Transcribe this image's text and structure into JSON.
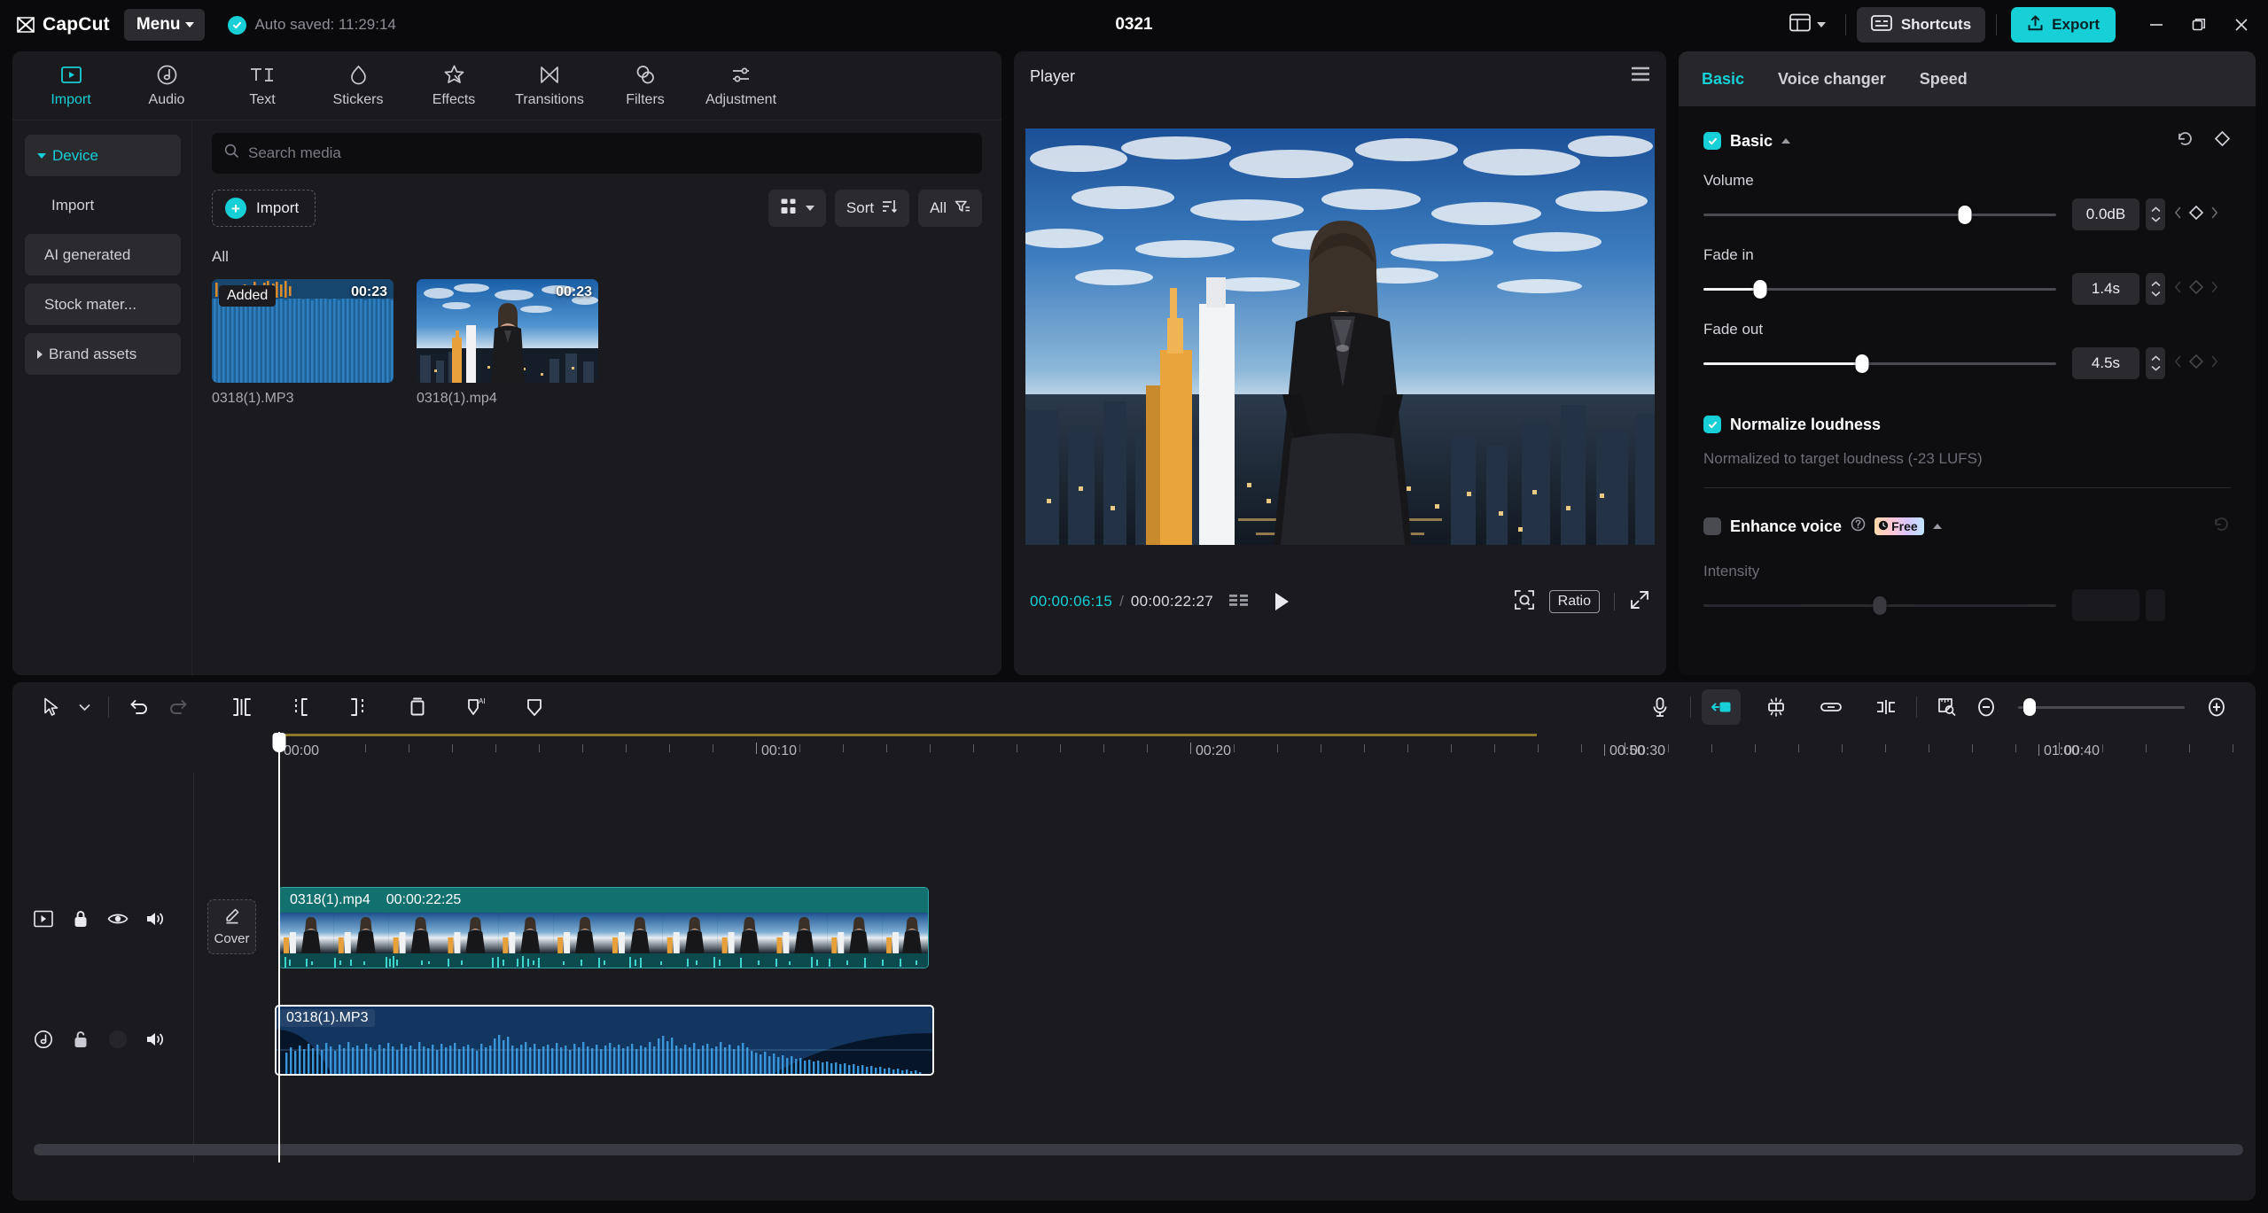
{
  "titlebar": {
    "brand": "CapCut",
    "menu_label": "Menu",
    "autosave_text": "Auto saved: 11:29:14",
    "project_title": "0321",
    "shortcuts_label": "Shortcuts",
    "export_label": "Export",
    "layout_icon": "layout-icon",
    "minimize_icon": "minimize-icon",
    "restore_icon": "restore-icon",
    "close_icon": "close-icon",
    "accent": "#17cfd6"
  },
  "tabs": [
    {
      "label": "Import",
      "icon": "import-icon",
      "active": true
    },
    {
      "label": "Audio",
      "icon": "audio-note-icon",
      "active": false
    },
    {
      "label": "Text",
      "icon": "text-ti-icon",
      "active": false
    },
    {
      "label": "Stickers",
      "icon": "sticker-drop-icon",
      "active": false
    },
    {
      "label": "Effects",
      "icon": "effects-star-icon",
      "active": false
    },
    {
      "label": "Transitions",
      "icon": "transitions-bowtie-icon",
      "active": false
    },
    {
      "label": "Filters",
      "icon": "filters-circles-icon",
      "active": false
    },
    {
      "label": "Adjustment",
      "icon": "adjustment-sliders-icon",
      "active": false
    }
  ],
  "sidebar": {
    "items": [
      {
        "label": "Device",
        "expanded": true,
        "active": true
      },
      {
        "label": "Import",
        "expanded": false,
        "active": false
      },
      {
        "label": "AI generated",
        "expanded": false,
        "active": false
      },
      {
        "label": "Stock mater...",
        "expanded": false,
        "active": false
      },
      {
        "label": "Brand assets",
        "expanded": false,
        "active": false
      }
    ]
  },
  "media": {
    "search_placeholder": "Search media",
    "search_value": "",
    "import_label": "Import",
    "grid_view_label": "grid-view-icon",
    "sort_label": "Sort",
    "filter_label": "All",
    "group_label": "All",
    "items": [
      {
        "name": "0318(1).MP3",
        "duration": "00:23",
        "badge": "Added",
        "kind": "audio"
      },
      {
        "name": "0318(1).mp4",
        "duration": "00:23",
        "badge": "",
        "kind": "video"
      }
    ]
  },
  "player": {
    "title": "Player",
    "menu_icon": "hamburger-icon",
    "current_time": "00:00:06:15",
    "time_separator": "/",
    "total_time": "00:00:22:27",
    "frames_icon": "frames-icon",
    "play_icon": "play-icon",
    "zoom_fit_icon": "zoom-fit-icon",
    "ratio_label": "Ratio",
    "fullscreen_icon": "fullscreen-icon"
  },
  "inspector": {
    "tabs": [
      {
        "label": "Basic",
        "active": true
      },
      {
        "label": "Voice changer",
        "active": false
      },
      {
        "label": "Speed",
        "active": false
      }
    ],
    "basic": {
      "title": "Basic",
      "enabled": true,
      "reset_icon": "reset-icon",
      "keyframe_icon": "keyframe-diamond-icon",
      "controls": [
        {
          "label": "Volume",
          "value": "0.0dB",
          "fill_pct": 74
        },
        {
          "label": "Fade in",
          "value": "1.4s",
          "fill_pct": 16
        },
        {
          "label": "Fade out",
          "value": "4.5s",
          "fill_pct": 45
        }
      ]
    },
    "normalize": {
      "label": "Normalize loudness",
      "enabled": true,
      "description": "Normalized to target loudness (-23 LUFS)"
    },
    "enhance": {
      "label": "Enhance voice",
      "enabled": false,
      "help_icon": "help-icon",
      "badge": "Free",
      "badge_icon": "clock-icon",
      "intensity_label": "Intensity",
      "reset_icon": "reset-icon"
    }
  },
  "timeline": {
    "tools_left": [
      {
        "name": "select-pointer-icon"
      },
      {
        "name": "chevron-down-icon"
      },
      {
        "name": "undo-icon"
      },
      {
        "name": "redo-icon"
      },
      {
        "name": "split-icon"
      },
      {
        "name": "trim-left-icon"
      },
      {
        "name": "trim-right-icon"
      },
      {
        "name": "delete-trash-icon"
      },
      {
        "name": "ai-mask-icon"
      },
      {
        "name": "mask-icon"
      }
    ],
    "tools_right": [
      {
        "name": "microphone-icon"
      },
      {
        "name": "magnetic-snap-icon",
        "active": true
      },
      {
        "name": "auto-adjust-icon"
      },
      {
        "name": "link-icon"
      },
      {
        "name": "split-marker-icon"
      },
      {
        "name": "ruler-zoom-icon"
      },
      {
        "name": "zoom-out-icon"
      },
      {
        "name": "zoom-in-icon"
      }
    ],
    "ruler_labels": [
      "00:00",
      "00:10",
      "00:20",
      "00:30",
      "00:40",
      "00:50",
      "01:00"
    ],
    "playhead_time": "00:00:06:15",
    "cover_label": "Cover",
    "tracks": [
      {
        "type": "video",
        "clip_name": "0318(1).mp4",
        "clip_duration": "00:00:22:25",
        "head_icons": [
          "track-preview-icon",
          "lock-icon",
          "eye-icon",
          "speaker-icon"
        ]
      },
      {
        "type": "audio",
        "clip_name": "0318(1).MP3",
        "head_icons": [
          "audio-note-icon",
          "lock-icon",
          "blank-icon",
          "speaker-icon"
        ]
      }
    ]
  }
}
